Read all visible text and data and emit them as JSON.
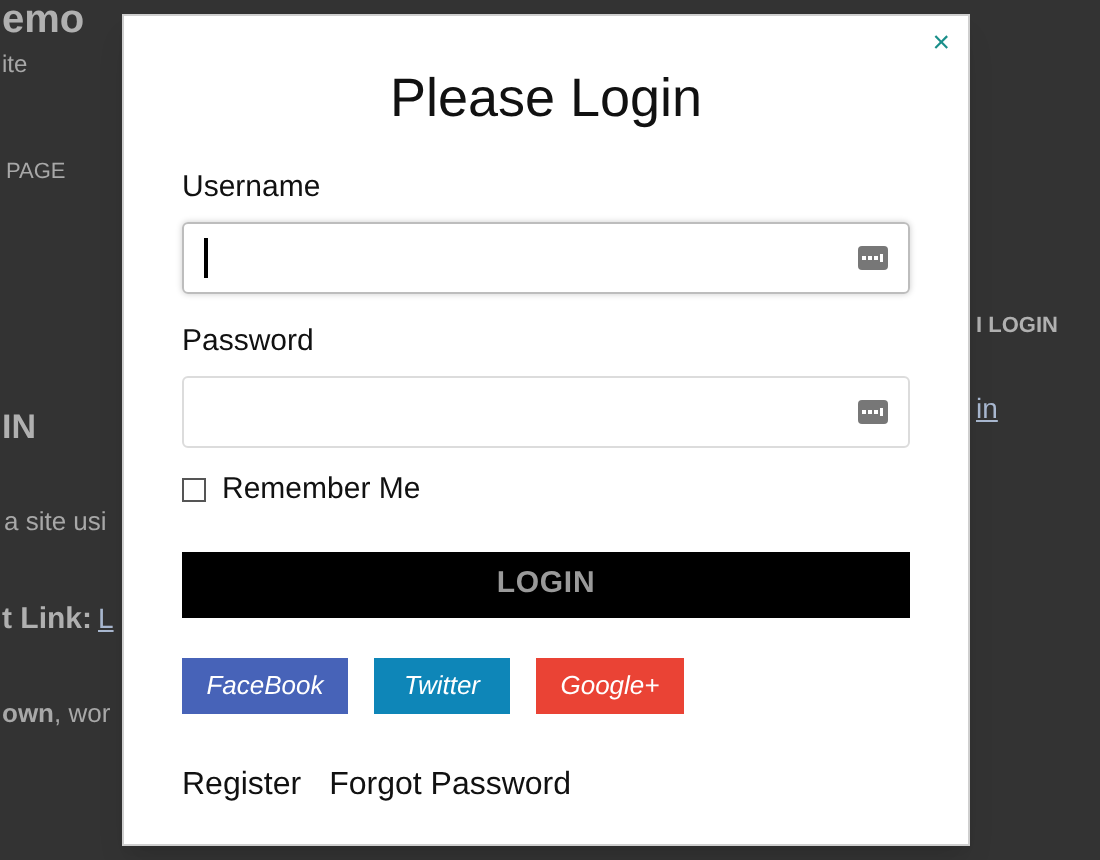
{
  "background_page": {
    "fragments": [
      {
        "kind": "title",
        "text": "emo"
      },
      {
        "kind": "tagline",
        "text": "ite"
      },
      {
        "kind": "nav",
        "text": "PAGE"
      },
      {
        "kind": "heading",
        "text": "IN"
      },
      {
        "kind": "body",
        "text": "a site usi"
      },
      {
        "kind": "bold",
        "text": "t Link:"
      },
      {
        "kind": "link",
        "text": "L"
      },
      {
        "kind": "body",
        "text": "**own**, wor"
      },
      {
        "kind": "widget_title",
        "text": "I LOGIN"
      },
      {
        "kind": "link",
        "text": "in"
      }
    ]
  },
  "dialog": {
    "title": "Please Login",
    "close": "×",
    "fields": [
      {
        "label": "Username",
        "focused": true
      },
      {
        "label": "Password",
        "focused": false
      }
    ],
    "remember": {
      "label": "Remember Me",
      "checked": false
    },
    "submit": "LOGIN",
    "social": [
      {
        "label": "FaceBook",
        "color": "#4763b8"
      },
      {
        "label": "Twitter",
        "color": "#0e86b8"
      },
      {
        "label": "Google+",
        "color": "#ea4335"
      }
    ],
    "links": [
      "Register",
      "Forgot Password"
    ]
  }
}
